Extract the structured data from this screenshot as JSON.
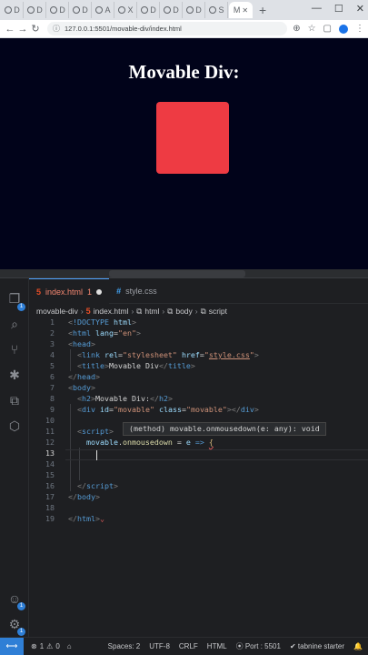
{
  "browser": {
    "tabs": [
      "D",
      "D",
      "D",
      "D",
      "A",
      "X",
      "D",
      "D",
      "D",
      "S"
    ],
    "active_tab_label": "M",
    "url": "127.0.0.1:5501/movable-div/index.html"
  },
  "page": {
    "title": "Movable Div:",
    "box_color": "#ee3b43",
    "background": "#01031a"
  },
  "editor": {
    "tabs": [
      {
        "label": "index.html",
        "error_count": "1"
      },
      {
        "label": "style.css"
      }
    ],
    "breadcrumb": [
      "movable-div",
      "index.html",
      "html",
      "body",
      "script"
    ],
    "lines": [
      "1",
      "2",
      "3",
      "4",
      "5",
      "6",
      "7",
      "8",
      "9",
      "10",
      "11",
      "12",
      "13",
      "14",
      "15",
      "16",
      "17",
      "18",
      "19"
    ],
    "hover_text": "(method) movable.onmousedown(e: any): void",
    "source_control_badge": "1",
    "account_badge": "1",
    "settings_badge": "1"
  },
  "status": {
    "errors": "1",
    "warnings": "0",
    "spaces": "Spaces: 2",
    "encoding": "UTF-8",
    "eol": "CRLF",
    "language": "HTML",
    "port": "Port : 5501",
    "tabnine": "tabnine starter"
  }
}
